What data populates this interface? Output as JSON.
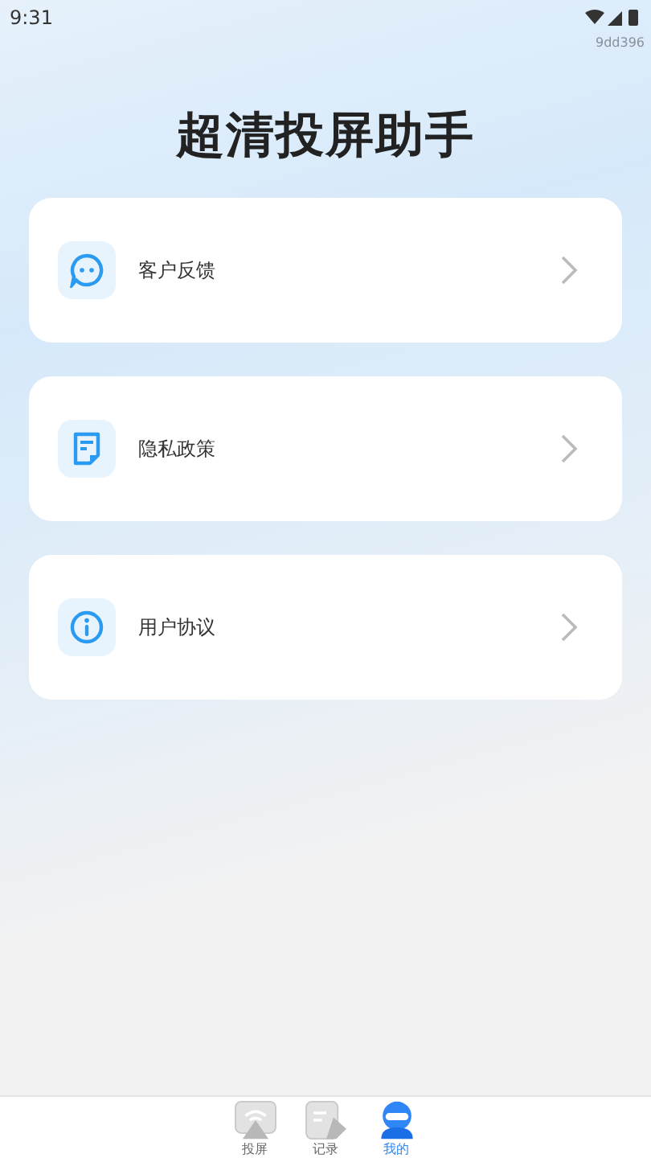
{
  "status_bar": {
    "time": "9:31"
  },
  "build_tag": "9dd396",
  "title": "超清投屏助手",
  "menu_items": [
    {
      "label": "客户反馈",
      "kind": "feedback"
    },
    {
      "label": "隐私政策",
      "kind": "privacy"
    },
    {
      "label": "用户协议",
      "kind": "agreement"
    }
  ],
  "tab_bar": [
    {
      "label": "投屏",
      "kind": "cast",
      "selected": false
    },
    {
      "label": "记录",
      "kind": "records",
      "selected": false
    },
    {
      "label": "我的",
      "kind": "mine",
      "selected": true
    }
  ]
}
